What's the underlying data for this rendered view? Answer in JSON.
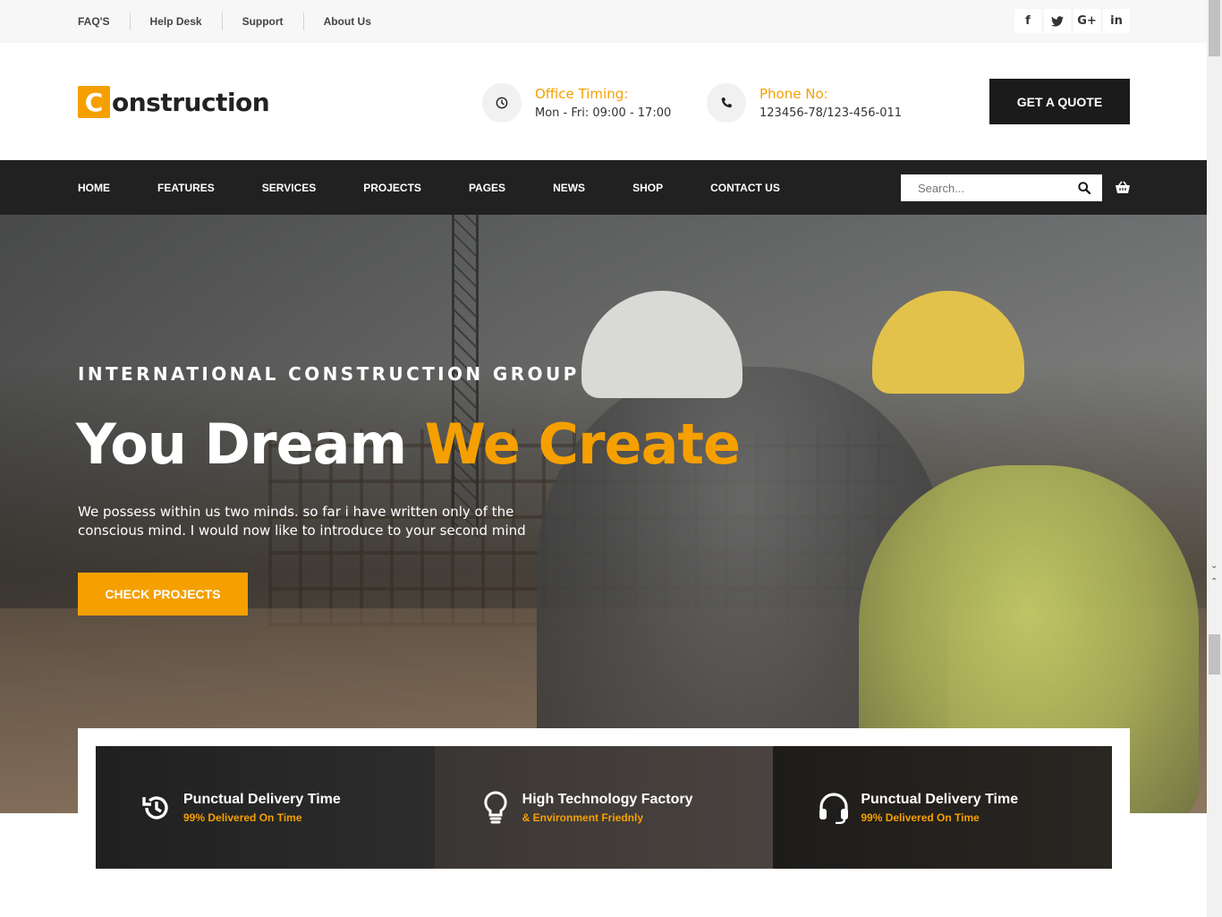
{
  "topbar": {
    "links": [
      "FAQ'S",
      "Help Desk",
      "Support",
      "About Us"
    ],
    "socials": [
      {
        "icon": "facebook-icon",
        "glyph": "f"
      },
      {
        "icon": "twitter-icon",
        "glyph": "t"
      },
      {
        "icon": "google-plus-icon",
        "glyph": "G+"
      },
      {
        "icon": "linkedin-icon",
        "glyph": "in"
      }
    ]
  },
  "header": {
    "logo_letter": "C",
    "logo_rest": "onstruction",
    "office_label": "Office Timing:",
    "office_value": "Mon - Fri: 09:00 - 17:00",
    "phone_label": "Phone No:",
    "phone_value": "123456-78/123-456-011",
    "quote_button": "GET A QUOTE"
  },
  "nav": {
    "items": [
      "HOME",
      "FEATURES",
      "SERVICES",
      "PROJECTS",
      "PAGES",
      "NEWS",
      "SHOP",
      "CONTACT US"
    ],
    "search_placeholder": "Search..."
  },
  "hero": {
    "subtitle": "INTERNATIONAL CONSTRUCTION GROUP",
    "title_main": "You Dream ",
    "title_accent": "We Create",
    "text": "We possess within us two minds. so far i have written only of the conscious mind. I would now like to introduce to your second mind",
    "button": "CHECK PROJECTS"
  },
  "features": [
    {
      "icon": "history-icon",
      "title": "Punctual Delivery Time",
      "subtitle": "99% Delivered On Time"
    },
    {
      "icon": "lightbulb-icon",
      "title": "High Technology Factory",
      "subtitle": "& Environment Friednly"
    },
    {
      "icon": "headset-icon",
      "title": "Punctual Delivery Time",
      "subtitle": "99% Delivered On Time"
    }
  ],
  "colors": {
    "accent": "#f5a000",
    "dark": "#212121"
  }
}
